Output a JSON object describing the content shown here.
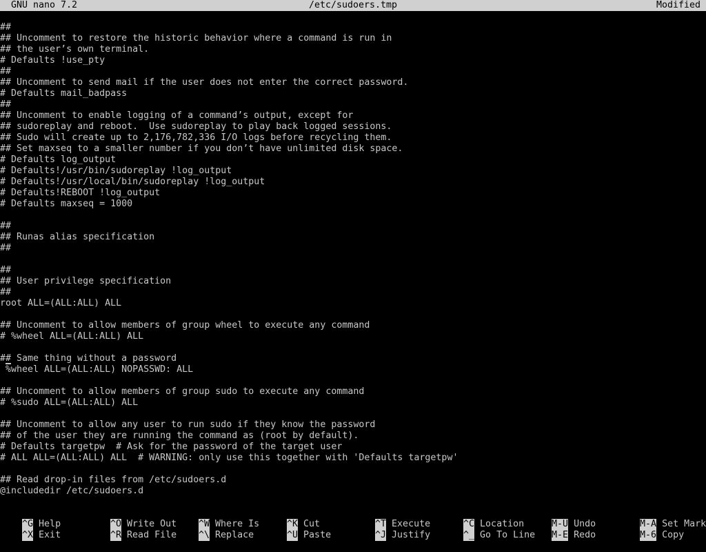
{
  "titlebar": {
    "app": "GNU nano 7.2",
    "file": "/etc/sudoers.tmp",
    "status": "Modified"
  },
  "editor": {
    "lines": [
      "##",
      "## Uncomment to restore the historic behavior where a command is run in",
      "## the user’s own terminal.",
      "# Defaults !use_pty",
      "##",
      "## Uncomment to send mail if the user does not enter the correct password.",
      "# Defaults mail_badpass",
      "##",
      "## Uncomment to enable logging of a command’s output, except for",
      "## sudoreplay and reboot.  Use sudoreplay to play back logged sessions.",
      "## Sudo will create up to 2,176,782,336 I/O logs before recycling them.",
      "## Set maxseq to a smaller number if you don’t have unlimited disk space.",
      "# Defaults log_output",
      "# Defaults!/usr/bin/sudoreplay !log_output",
      "# Defaults!/usr/local/bin/sudoreplay !log_output",
      "# Defaults!REBOOT !log_output",
      "# Defaults maxseq = 1000",
      "",
      "##",
      "## Runas alias specification",
      "##",
      "",
      "##",
      "## User privilege specification",
      "##",
      "root ALL=(ALL:ALL) ALL",
      "",
      "## Uncomment to allow members of group wheel to execute any command",
      "# %wheel ALL=(ALL:ALL) ALL",
      "",
      "## Same thing without a password",
      " %wheel ALL=(ALL:ALL) NOPASSWD: ALL",
      "",
      "## Uncomment to allow members of group sudo to execute any command",
      "# %sudo ALL=(ALL:ALL) ALL",
      "",
      "## Uncomment to allow any user to run sudo if they know the password",
      "## of the user they are running the command as (root by default).",
      "# Defaults targetpw  # Ask for the password of the target user",
      "# ALL ALL=(ALL:ALL) ALL  # WARNING: only use this together with 'Defaults targetpw'",
      "",
      "## Read drop-in files from /etc/sudoers.d",
      "@includedir /etc/sudoers.d"
    ]
  },
  "shortcuts": {
    "row1": [
      {
        "key": "^G",
        "label": "Help"
      },
      {
        "key": "^O",
        "label": "Write Out"
      },
      {
        "key": "^W",
        "label": "Where Is"
      },
      {
        "key": "^K",
        "label": "Cut"
      },
      {
        "key": "^T",
        "label": "Execute"
      },
      {
        "key": "^C",
        "label": "Location"
      },
      {
        "key": "M-U",
        "label": "Undo"
      },
      {
        "key": "M-A",
        "label": "Set Mark"
      }
    ],
    "row2": [
      {
        "key": "^X",
        "label": "Exit"
      },
      {
        "key": "^R",
        "label": "Read File"
      },
      {
        "key": "^\\",
        "label": "Replace"
      },
      {
        "key": "^U",
        "label": "Paste"
      },
      {
        "key": "^J",
        "label": "Justify"
      },
      {
        "key": "^_",
        "label": "Go To Line"
      },
      {
        "key": "M-E",
        "label": "Redo"
      },
      {
        "key": "M-6",
        "label": "Copy"
      }
    ]
  },
  "colors": {
    "background": "#000000",
    "foreground": "#c8c8c8",
    "bar": "#d0d0d0"
  }
}
